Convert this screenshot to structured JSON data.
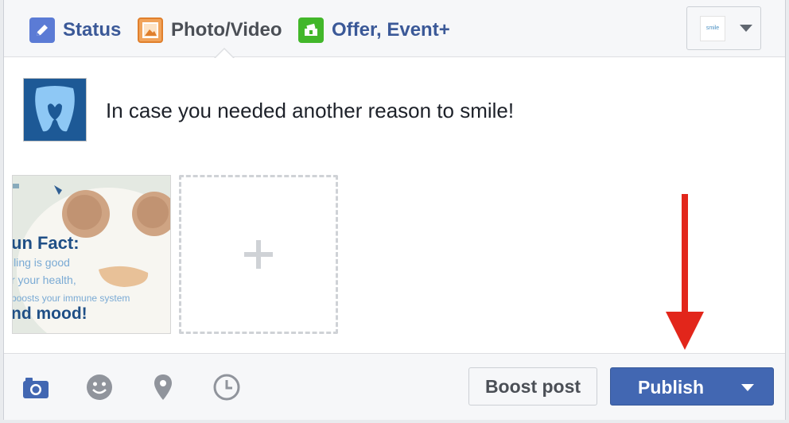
{
  "tabs": [
    {
      "label": "Status",
      "icon": "pencil-icon"
    },
    {
      "label": "Photo/Video",
      "icon": "photo-icon"
    },
    {
      "label": "Offer, Event+",
      "icon": "offer-icon"
    }
  ],
  "page_selector": {
    "thumb_text": "smile",
    "icon": "page-logo-icon"
  },
  "post": {
    "text": "In case you needed another reason to smile!",
    "avatar_icon": "tooth-logo-icon"
  },
  "photo": {
    "lines": [
      "un Fact:",
      "iling is good",
      "r your health,",
      "boosts your immune system",
      "nd mood!"
    ]
  },
  "add_photo_icon": "plus-icon",
  "toolbar": {
    "icons": [
      "camera-icon",
      "emoji-icon",
      "location-pin-icon",
      "clock-icon"
    ],
    "boost_label": "Boost post",
    "publish_label": "Publish"
  },
  "colors": {
    "accent": "#4267b2",
    "link": "#3b5998",
    "annotation_arrow": "#e2261b"
  }
}
